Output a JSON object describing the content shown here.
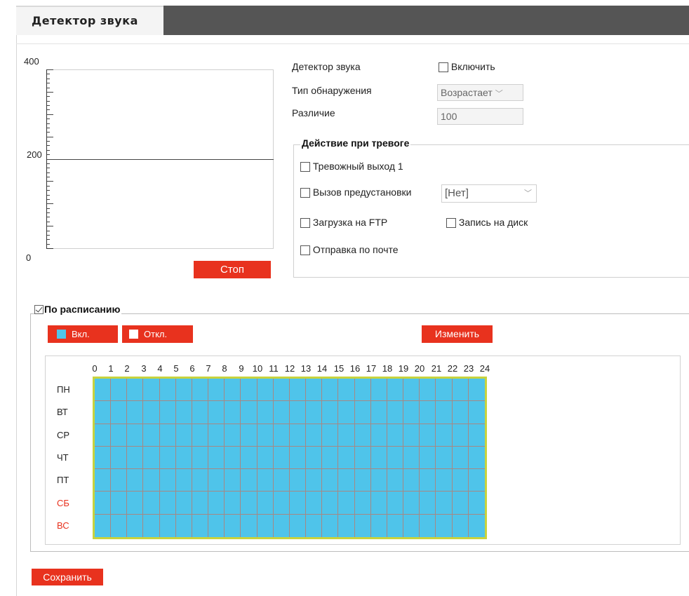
{
  "tab": {
    "title": "Детектор звука"
  },
  "graph": {
    "y_max": "400",
    "y_mid": "200",
    "y_min": "0",
    "level": 200,
    "stop_label": "Стоп"
  },
  "form": {
    "detector_label": "Детектор звука",
    "enable_label": "Включить",
    "enabled": false,
    "detection_type_label": "Тип обнаружения",
    "detection_type_value": "Возрастает",
    "difference_label": "Различие",
    "difference_value": "100"
  },
  "alarm": {
    "title": "Действие при тревоге",
    "alarm_out_label": "Тревожный выход 1",
    "preset_label": "Вызов предустановки",
    "preset_value": "[Нет]",
    "ftp_label": "Загрузка на FTP",
    "disk_label": "Запись на диск",
    "email_label": "Отправка по почте"
  },
  "schedule": {
    "label": "По расписанию",
    "enabled": true,
    "on_label": "Вкл.",
    "off_label": "Откл.",
    "edit_label": "Изменить",
    "hours": [
      "0",
      "1",
      "2",
      "3",
      "4",
      "5",
      "6",
      "7",
      "8",
      "9",
      "10",
      "11",
      "12",
      "13",
      "14",
      "15",
      "16",
      "17",
      "18",
      "19",
      "20",
      "21",
      "22",
      "23",
      "24"
    ],
    "days": [
      "ПН",
      "ВТ",
      "СР",
      "ЧТ",
      "ПТ",
      "СБ",
      "ВС"
    ],
    "colors": {
      "on": "#4fc4ea",
      "off": "#ffffff",
      "weekend": "#e8321e",
      "accent": "#e8321e"
    }
  },
  "save_label": "Сохранить"
}
